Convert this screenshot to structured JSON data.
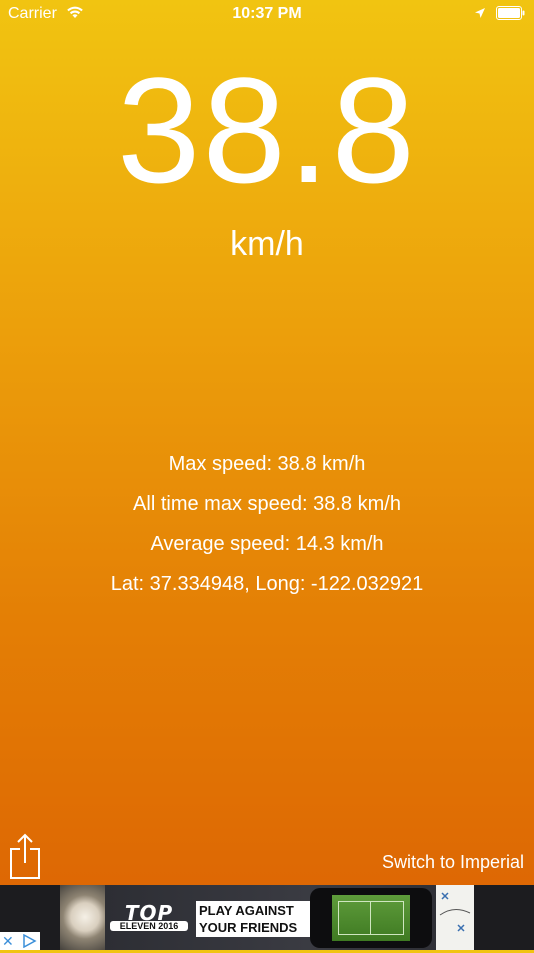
{
  "status_bar": {
    "carrier": "Carrier",
    "time": "10:37 PM",
    "icons": [
      "wifi-icon",
      "location-arrow-icon",
      "battery-icon"
    ]
  },
  "speedometer": {
    "value": "38.8",
    "unit": "km/h"
  },
  "stats": {
    "max_speed": "Max speed: 38.8 km/h",
    "all_time_max": "All time max speed: 38.8 km/h",
    "average_speed": "Average speed: 14.3 km/h",
    "coordinates": "Lat: 37.334948, Long: -122.032921"
  },
  "toolbar": {
    "share_icon": "share-icon",
    "switch_units_label": "Switch to Imperial"
  },
  "ad": {
    "brand_top": "TOP",
    "brand_bottom": "ELEVEN 2016",
    "headline": "PLAY AGAINST YOUR FRIENDS",
    "choice_icons": [
      "close-icon",
      "ad-choices-icon"
    ]
  },
  "colors": {
    "gradient_top": "#f1c411",
    "gradient_bottom": "#dc6203",
    "text": "#ffffff"
  }
}
